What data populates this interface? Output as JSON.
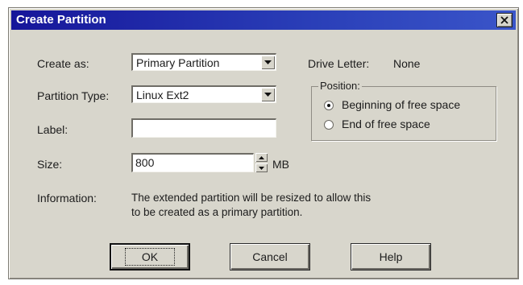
{
  "dialog": {
    "title": "Create Partition",
    "close_icon": "close-icon",
    "create_as_label": "Create as:",
    "create_as_value": "Primary Partition",
    "partition_type_label": "Partition Type:",
    "partition_type_value": "Linux Ext2",
    "label_label": "Label:",
    "label_value": "",
    "size_label": "Size:",
    "size_value": "800",
    "size_unit": "MB",
    "information_label": "Information:",
    "information_line1": "The extended partition will be resized to allow this",
    "information_line2": "to be created as a primary partition.",
    "drive_letter_label": "Drive Letter:",
    "drive_letter_value": "None",
    "position_group_label": "Position:",
    "position_options": [
      {
        "label": "Beginning of free space",
        "selected": true
      },
      {
        "label": "End of free space",
        "selected": false
      }
    ],
    "buttons": {
      "ok": "OK",
      "cancel": "Cancel",
      "help": "Help"
    }
  }
}
